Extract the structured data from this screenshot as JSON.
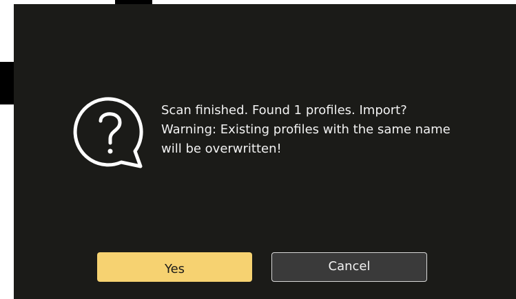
{
  "dialog": {
    "message_lines": [
      "Scan finished. Found 1 profiles. Import?",
      "Warning: Existing profiles with the same name",
      "will be overwritten!"
    ],
    "icon": "question-bubble-icon",
    "yes_label": "Yes",
    "cancel_label": "Cancel"
  },
  "colors": {
    "background": "#1b1b18",
    "accent": "#f6d271",
    "text": "#f2f2f2"
  }
}
